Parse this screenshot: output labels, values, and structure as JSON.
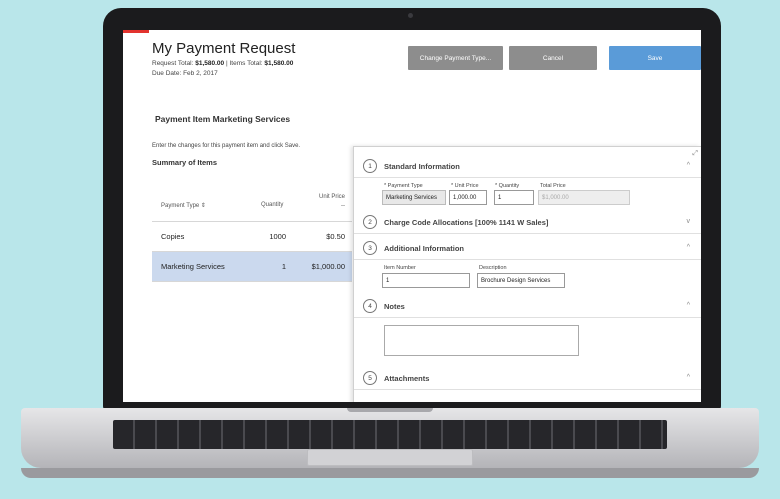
{
  "header": {
    "title": "My Payment Request",
    "request_total_label": "Request Total:",
    "request_total": "$1,580.00",
    "items_total_label": "Items Total:",
    "items_total": "$1,580.00",
    "due_date": "Due Date: Feb 2, 2017"
  },
  "toolbar": {
    "change_type_label": "Change Payment Type...",
    "cancel_label": "Cancel",
    "save_label": "Save"
  },
  "main": {
    "section_title": "Payment Item Marketing Services",
    "instructions": "Enter the changes for this payment item and click Save.",
    "summary_title": "Summary of Items"
  },
  "table": {
    "headers": {
      "type": "Payment Type ⇕",
      "quantity": "Quantity",
      "unit_price": "Unit Price",
      "unit_price_sub": "--"
    },
    "rows": [
      {
        "type": "Copies",
        "quantity": "1000",
        "price": "$0.50"
      },
      {
        "type": "Marketing Services",
        "quantity": "1",
        "price": "$1,000.00"
      }
    ]
  },
  "panel": {
    "sections": [
      {
        "num": "1",
        "label": "Standard Information",
        "chevron": "^"
      },
      {
        "num": "2",
        "label": "Charge Code Allocations [100% 1141 W Sales]",
        "chevron": "v"
      },
      {
        "num": "3",
        "label": "Additional Information",
        "chevron": "^"
      },
      {
        "num": "4",
        "label": "Notes",
        "chevron": "^"
      },
      {
        "num": "5",
        "label": "Attachments",
        "chevron": "^"
      }
    ],
    "standard": {
      "payment_type_label": "* Payment Type",
      "payment_type_value": "Marketing Services",
      "unit_price_label": "* Unit Price",
      "unit_price_value": "1,000.00",
      "quantity_label": "* Quantity",
      "quantity_value": "1",
      "total_price_label": "Total Price",
      "total_price_value": "$1,000.00"
    },
    "additional": {
      "item_number_label": "Item Number",
      "item_number_value": "1",
      "description_label": "Description",
      "description_value": "Brochure Design Services"
    },
    "expand_icon": "⤢"
  }
}
